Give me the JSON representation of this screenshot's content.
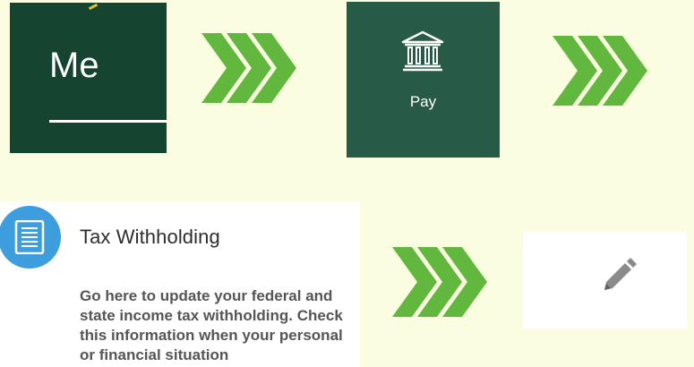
{
  "me_tile": {
    "label": "Me"
  },
  "pay_tile": {
    "icon": "bank-icon",
    "label": "Pay"
  },
  "tax_card": {
    "icon": "document-icon",
    "title": "Tax Withholding",
    "description": "Go here to update your federal and state income tax withholding. Check this information when your personal or financial situation"
  },
  "edit_tile": {
    "icon": "pencil-icon"
  },
  "flow": {
    "arrow_icon": "triple-chevron-right-icon",
    "arrow_color": "#62b83f"
  },
  "colors": {
    "background": "#fbfde0",
    "me_tile": "#154530",
    "pay_tile": "#285a48",
    "doc_icon_circle": "#3e9edd"
  }
}
